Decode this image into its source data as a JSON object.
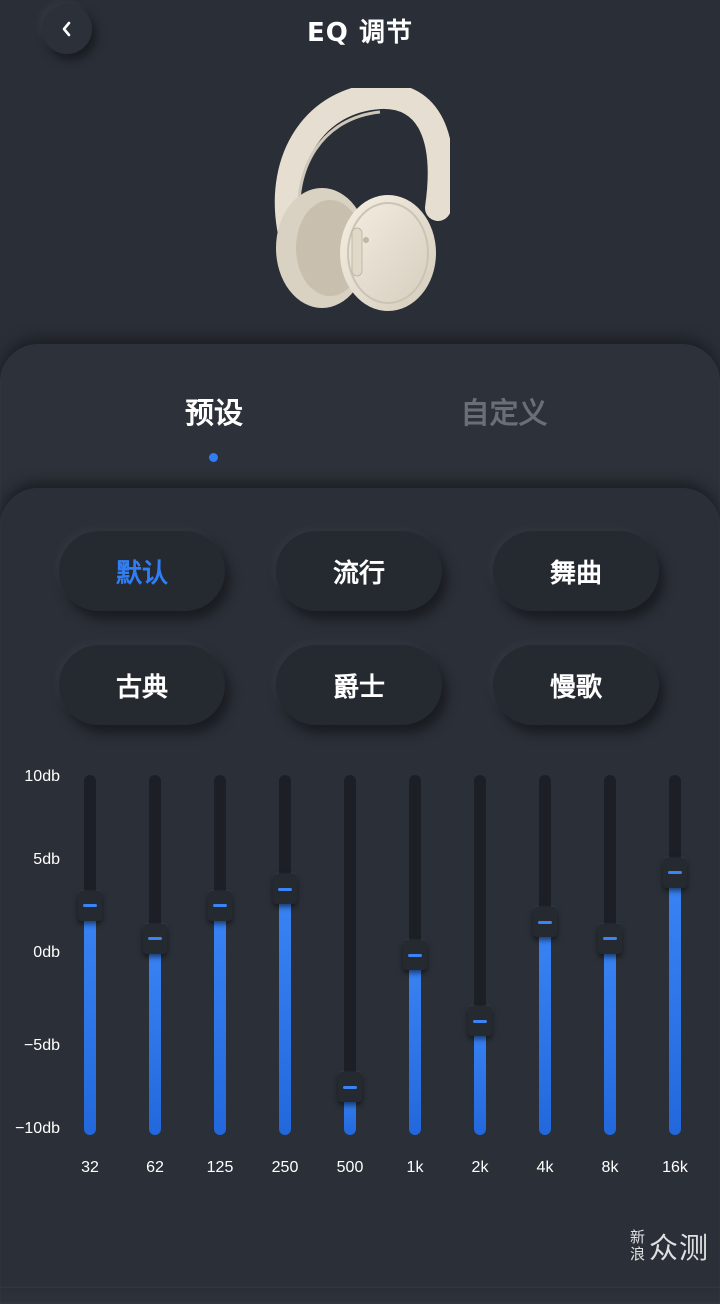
{
  "header": {
    "title": "EQ 调节",
    "back_icon": "chevron-left-icon"
  },
  "product": {
    "image": "white-headphones",
    "colors": {
      "body": "#e8e1d3"
    }
  },
  "tabs": [
    {
      "label": "预设",
      "active": true
    },
    {
      "label": "自定义",
      "active": false
    }
  ],
  "presets": [
    {
      "label": "默认",
      "active": true
    },
    {
      "label": "流行",
      "active": false
    },
    {
      "label": "舞曲",
      "active": false
    },
    {
      "label": "古典",
      "active": false
    },
    {
      "label": "爵士",
      "active": false
    },
    {
      "label": "慢歌",
      "active": false
    }
  ],
  "eq": {
    "y_labels": [
      "10db",
      "5db",
      "0db",
      "−5db",
      "−10db"
    ],
    "range_db": [
      -10,
      10
    ],
    "bands": [
      {
        "freq": "32",
        "gain_db": 3
      },
      {
        "freq": "62",
        "gain_db": 1
      },
      {
        "freq": "125",
        "gain_db": 3
      },
      {
        "freq": "250",
        "gain_db": 4
      },
      {
        "freq": "500",
        "gain_db": -8
      },
      {
        "freq": "1k",
        "gain_db": 0
      },
      {
        "freq": "2k",
        "gain_db": -4
      },
      {
        "freq": "4k",
        "gain_db": 2
      },
      {
        "freq": "8k",
        "gain_db": 1
      },
      {
        "freq": "16k",
        "gain_db": 5
      }
    ]
  },
  "watermark": {
    "small_top": "新",
    "small_bottom": "浪",
    "big": "众测"
  },
  "colors": {
    "accent": "#2f7ef5",
    "background": "#2a2f37",
    "inactive_tab": "#6a6f77"
  }
}
